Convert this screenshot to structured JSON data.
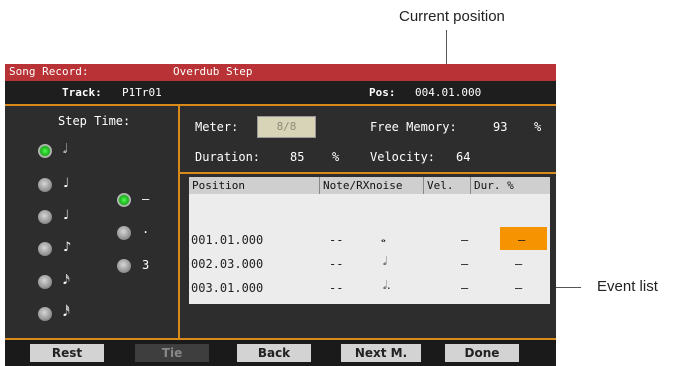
{
  "callouts": {
    "current_position": "Current position",
    "event_list": "Event list"
  },
  "titlebar": {
    "mode": "Song Record:",
    "submode": "Overdub Step"
  },
  "trackbar": {
    "track_label": "Track:",
    "track_value": "P1Tr01",
    "pos_label": "Pos:",
    "pos_value": "004.01.000"
  },
  "step_time": {
    "title": "Step Time:",
    "durations": [
      {
        "icon": "half-note-icon",
        "glyph": "𝅗𝅥",
        "selected": true
      },
      {
        "icon": "quarter-note-icon",
        "glyph": "♩",
        "selected": false
      },
      {
        "icon": "quarter-note-icon",
        "glyph": "♩",
        "selected": false
      },
      {
        "icon": "eighth-note-icon",
        "glyph": "♪",
        "selected": false
      },
      {
        "icon": "sixteenth-note-icon",
        "glyph": "𝅘𝅥𝅯",
        "selected": false
      },
      {
        "icon": "thirty-second-note-icon",
        "glyph": "𝅘𝅥𝅰",
        "selected": false
      }
    ],
    "modifiers": [
      {
        "label": "—",
        "selected": true
      },
      {
        "label": ".",
        "selected": false
      },
      {
        "label": "3",
        "selected": false
      }
    ]
  },
  "params": {
    "meter_label": "Meter:",
    "meter_value": "8/8",
    "free_memory_label": "Free Memory:",
    "free_memory_value": "93",
    "free_memory_unit": "%",
    "duration_label": "Duration:",
    "duration_value": "85",
    "duration_unit": "%",
    "velocity_label": "Velocity:",
    "velocity_value": "64"
  },
  "event_list": {
    "columns": [
      "Position",
      "Note/RXnoise",
      "Vel.",
      "Dur. %"
    ],
    "rows": [
      {
        "position": "001.01.000",
        "note": "--",
        "symbol": "𝅝",
        "vel": "–",
        "dur": "–"
      },
      {
        "position": "002.03.000",
        "note": "--",
        "symbol": "𝅗𝅥",
        "vel": "–",
        "dur": "–"
      },
      {
        "position": "003.01.000",
        "note": "--",
        "symbol": "𝅗𝅥.",
        "vel": "–",
        "dur": "–"
      }
    ]
  },
  "buttons": [
    {
      "label": "Rest",
      "enabled": true
    },
    {
      "label": "Tie",
      "enabled": false
    },
    {
      "label": "Back",
      "enabled": true
    },
    {
      "label": "Next M.",
      "enabled": true
    },
    {
      "label": "Done",
      "enabled": true
    }
  ],
  "colors": {
    "titlebar": "#b83236",
    "highlight": "#f59300",
    "frame": "#d88a1a",
    "selected_radio": "#2fd22f"
  }
}
